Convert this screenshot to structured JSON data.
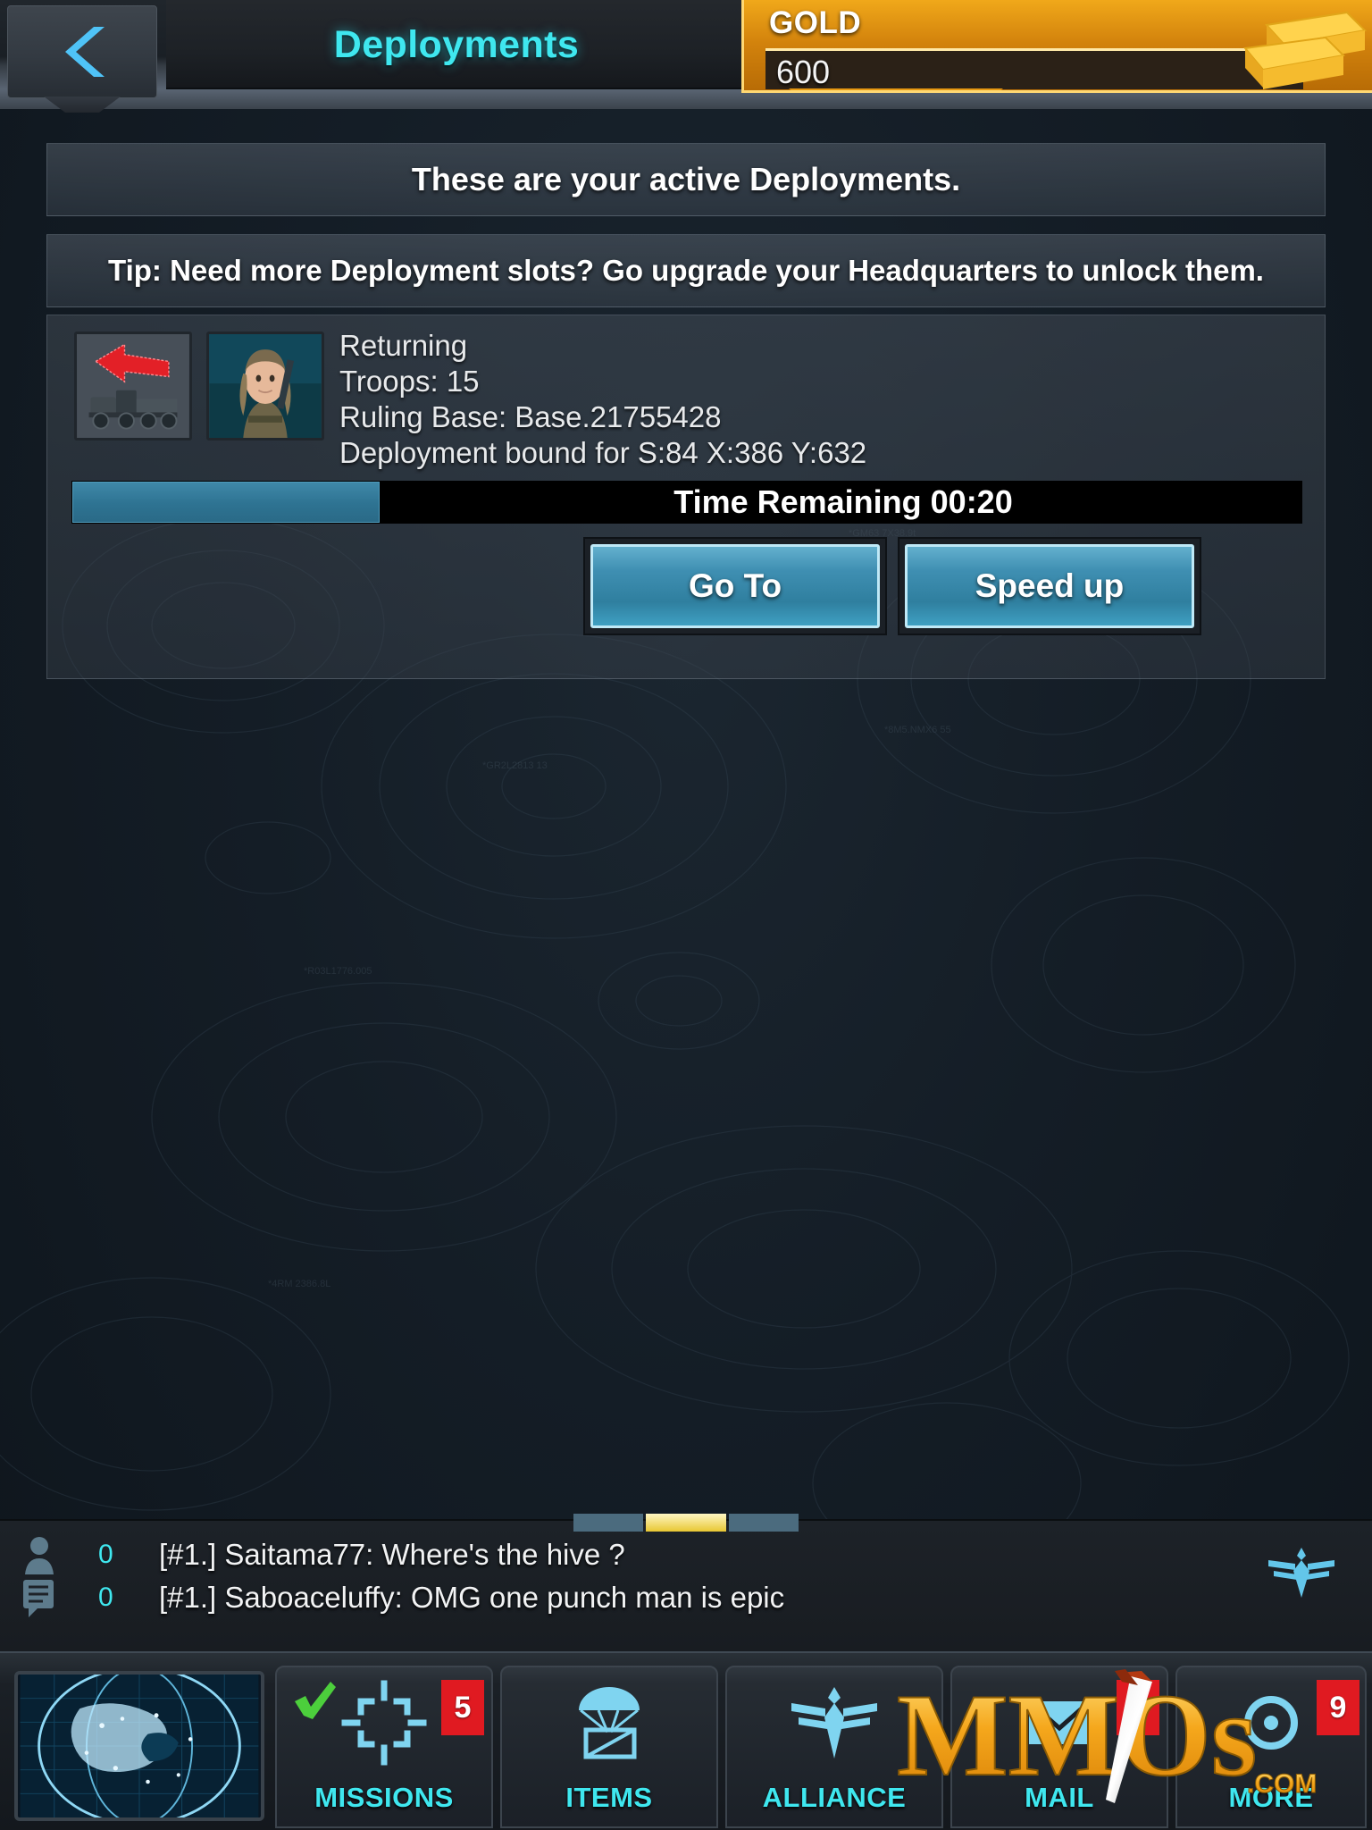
{
  "header": {
    "title": "Deployments",
    "back_icon": "chevron-left-icon",
    "gold": {
      "label": "GOLD",
      "value": "600",
      "icon": "gold-bars-icon"
    }
  },
  "banner": {
    "text": "These are your active Deployments."
  },
  "tip": {
    "text": "Tip: Need more Deployment slots? Go upgrade your Headquarters to unlock them."
  },
  "deployment": {
    "truck_icon": "troop-transport-truck-icon",
    "arrow_icon": "red-return-arrow-icon",
    "portrait_icon": "officer-portrait-icon",
    "status": "Returning",
    "troops": "Troops: 15",
    "ruling_base": "Ruling Base: Base.21755428",
    "bound_for": "Deployment bound for S:84 X:386 Y:632",
    "progress_percent": 25,
    "progress_fill_color": "#2e7392",
    "time_remaining": "Time Remaining 00:20",
    "goto_label": "Go To",
    "speedup_label": "Speed up"
  },
  "chat": {
    "user_count": "0",
    "message_count": "0",
    "messages": [
      "[#1.] Saitama77:  Where's the hive ?",
      "[#1.] Saboaceluffy: OMG one punch man is epic"
    ],
    "eagle_icon": "alliance-eagle-icon",
    "person_icon": "person-icon",
    "chatlines_icon": "chat-lines-icon"
  },
  "nav": {
    "globe_icon": "world-globe-icon",
    "items": [
      {
        "label": "MISSIONS",
        "icon": "crosshair-icon",
        "badge": "5",
        "checked": true
      },
      {
        "label": "ITEMS",
        "icon": "parachute-crate-icon",
        "badge": "",
        "checked": false
      },
      {
        "label": "ALLIANCE",
        "icon": "eagle-emblem-icon",
        "badge": "",
        "checked": false
      },
      {
        "label": "MAIL",
        "icon": "envelope-icon",
        "badge": "5",
        "checked": false
      },
      {
        "label": "MORE",
        "icon": "more-gear-icon",
        "badge": "9",
        "checked": false
      }
    ]
  },
  "watermark": {
    "text": "MMOs",
    "suffix": ".COM"
  },
  "colors": {
    "accent_cyan": "#3fe7ef",
    "gold": "#f0a81a",
    "badge_red": "#e01a21",
    "button_blue": "#3f8fb2"
  }
}
